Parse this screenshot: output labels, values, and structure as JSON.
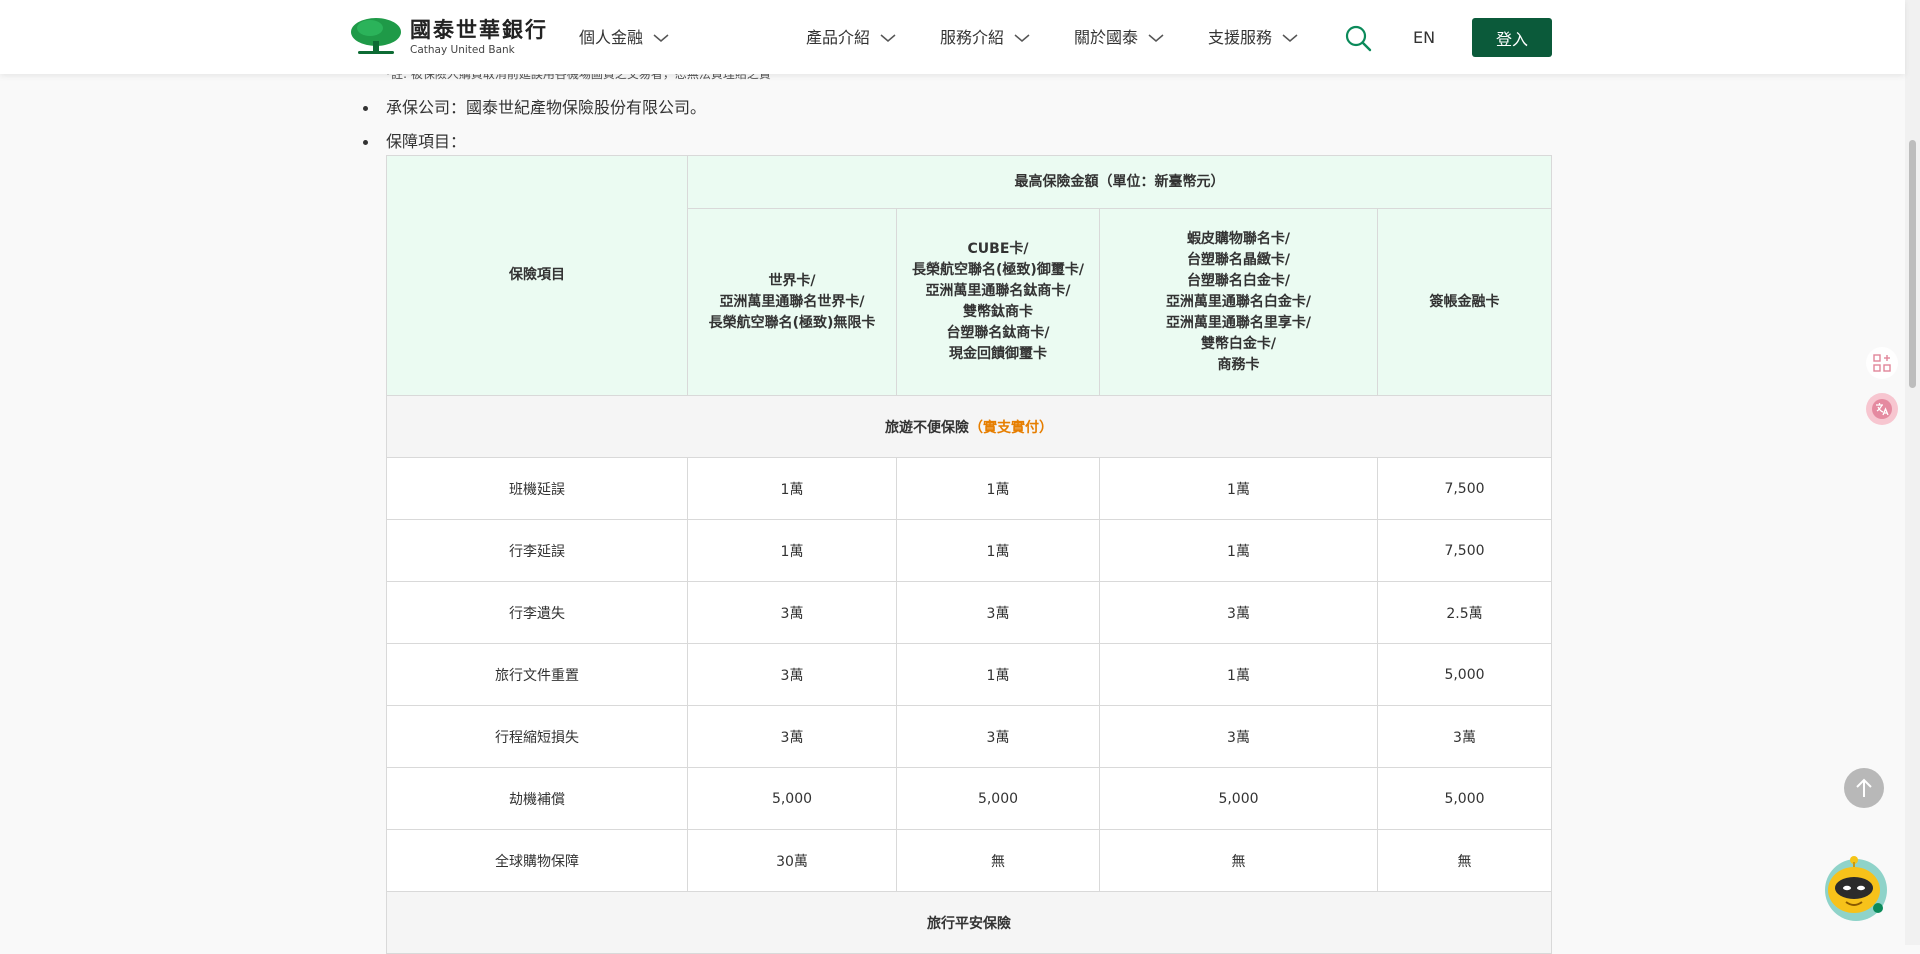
{
  "header": {
    "logo_zh": "國泰世華銀行",
    "logo_en": "Cathay United Bank",
    "nav": {
      "personal": "個人金融",
      "products": "產品介紹",
      "services": "服務介紹",
      "about": "關於國泰",
      "support": "支援服務"
    },
    "lang": "EN",
    "login": "登入"
  },
  "content": {
    "note": "*註: 被保險人購買取消前延誤用各機場圖資之交易者，恕無法負理賠之責",
    "insurer": "承保公司：國泰世紀產物保險股份有限公司。",
    "coverage_label": "保障項目："
  },
  "table": {
    "item_header": "保險項目",
    "amount_header": "最高保險金額（單位：新臺幣元）",
    "card_groups": [
      [
        "世界卡/",
        "亞洲萬里通聯名世界卡/",
        "長榮航空聯名(極致)無限卡"
      ],
      [
        "CUBE卡/",
        "長榮航空聯名(極致)御璽卡/",
        "亞洲萬里通聯名鈦商卡/",
        "雙幣鈦商卡",
        "台塑聯名鈦商卡/",
        "現金回饋御璽卡"
      ],
      [
        "蝦皮購物聯名卡/",
        "台塑聯名晶緻卡/",
        "台塑聯名白金卡/",
        "亞洲萬里通聯名白金卡/",
        "亞洲萬里通聯名里享卡/",
        "雙幣白金卡/",
        "商務卡"
      ],
      [
        "簽帳金融卡"
      ]
    ],
    "section1": {
      "title": "旅遊不便保險",
      "tag": "（實支實付）"
    },
    "rows": [
      {
        "item": "班機延誤",
        "values": [
          "1萬",
          "1萬",
          "1萬",
          "7,500"
        ]
      },
      {
        "item": "行李延誤",
        "values": [
          "1萬",
          "1萬",
          "1萬",
          "7,500"
        ]
      },
      {
        "item": "行李遺失",
        "values": [
          "3萬",
          "3萬",
          "3萬",
          "2.5萬"
        ]
      },
      {
        "item": "旅行文件重置",
        "values": [
          "3萬",
          "1萬",
          "1萬",
          "5,000"
        ]
      },
      {
        "item": "行程縮短損失",
        "values": [
          "3萬",
          "3萬",
          "3萬",
          "3萬"
        ]
      },
      {
        "item": "劫機補償",
        "values": [
          "5,000",
          "5,000",
          "5,000",
          "5,000"
        ]
      },
      {
        "item": "全球購物保障",
        "values": [
          "30萬",
          "無",
          "無",
          "無"
        ]
      }
    ],
    "section2": {
      "title": "旅行平安保險"
    }
  },
  "colors": {
    "brand_green": "#0b5a3a",
    "header_bg": "#ebfbf2",
    "accent_orange": "#e67e00"
  },
  "icons": [
    "tree-logo-icon",
    "chevron-down-icon",
    "search-icon",
    "apps-icon",
    "translate-icon",
    "arrow-up-icon",
    "chatbot-icon"
  ]
}
